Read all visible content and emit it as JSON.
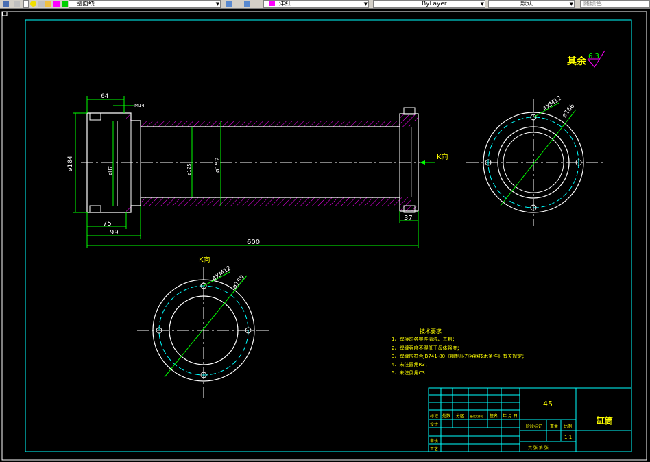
{
  "toolbar": {
    "layer_name": "剖面线",
    "color_name": "洋红",
    "linetype": "ByLayer",
    "lineweight": "默认",
    "plotstyle": "随颜色"
  },
  "drawing": {
    "roughness_label": "其余",
    "roughness_value": "6.3",
    "k_view_arrow": "K向",
    "k_view_title": "K向",
    "dims": {
      "d64": "64",
      "m14": "M14",
      "d184": "ø184",
      "d117": "øH7",
      "d125": "ø125",
      "d152": "ø152",
      "d75": "75",
      "d99": "99",
      "d600": "600",
      "d37": "37",
      "holes_right": "4XM12",
      "pcd_right": "ø166",
      "holes_k": "4XM12",
      "pcd_k": "ø159"
    },
    "tech_req": {
      "title": "技术要求",
      "lines": [
        "1、焊接前各零件清洗、去刺；",
        "2、焊缝强度不得低于母体强度；",
        "3、焊缝应符合JB741-80《钢制压力容器技术条件》有关规定；",
        "4、未注圆角R3；",
        "5、未注倒角C3"
      ]
    },
    "title_block": {
      "material": "45",
      "part_name": "缸筒",
      "scale": "1:1",
      "r_mark": "标记",
      "r_count": "处数",
      "r_zone": "分区",
      "r_docno": "更改文件号",
      "r_sign": "签名",
      "r_date": "年 月 日",
      "r_design": "设计",
      "r_review": "审核",
      "r_process": "工艺",
      "r_stage": "阶段标记",
      "r_weight": "重量",
      "r_ratio": "比例",
      "r_sheets": "共  张  第  张"
    }
  }
}
